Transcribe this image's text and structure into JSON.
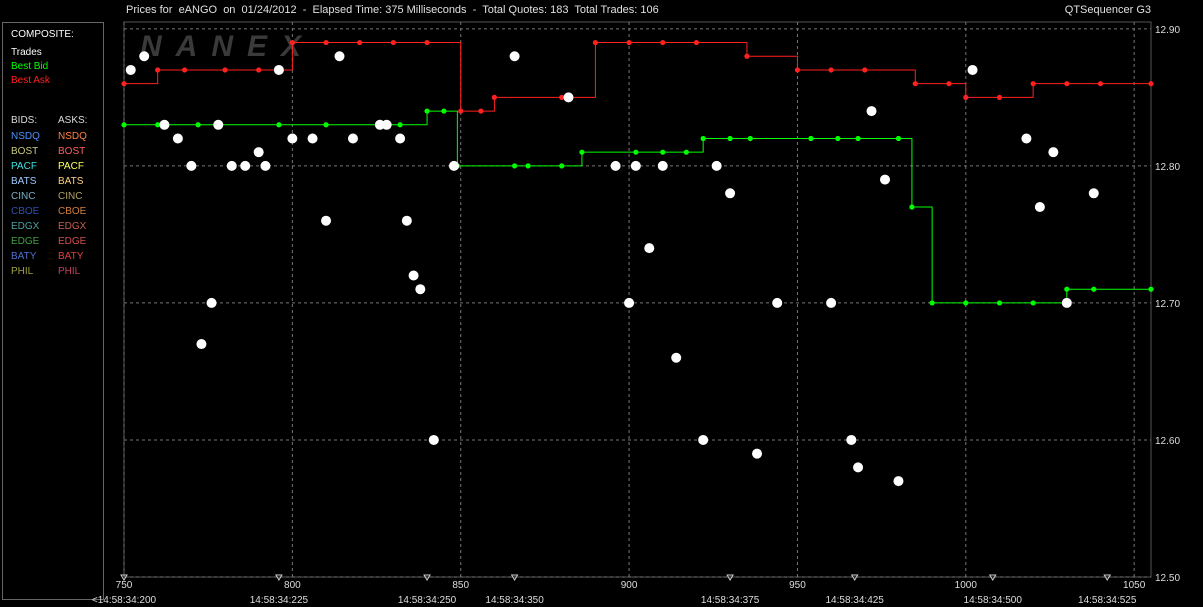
{
  "header": {
    "title": "Prices for  eANGO  on  01/24/2012  -  Elapsed Time: 375 Milliseconds  -  Total Quotes: 183  Total Trades: 106",
    "product": "QTSequencer G3",
    "watermark": "NANEX"
  },
  "legend": {
    "composite_label": "COMPOSITE:",
    "composite": [
      {
        "label": "Trades",
        "color": "#ffffff"
      },
      {
        "label": "Best Bid",
        "color": "#00ff00"
      },
      {
        "label": "Best Ask",
        "color": "#ff2020"
      }
    ],
    "bids_label": "BIDS:",
    "asks_label": "ASKS:",
    "bids": [
      {
        "label": "NSDQ",
        "color": "#4a90ff"
      },
      {
        "label": "BOST",
        "color": "#c8c87a"
      },
      {
        "label": "PACF",
        "color": "#40e0e0"
      },
      {
        "label": "BATS",
        "color": "#a0c8ff"
      },
      {
        "label": "CINC",
        "color": "#7ab0c8"
      },
      {
        "label": "CBOE",
        "color": "#3050b0"
      },
      {
        "label": "EDGX",
        "color": "#4aa0a0"
      },
      {
        "label": "EDGE",
        "color": "#40a040"
      },
      {
        "label": "BATY",
        "color": "#5070d0"
      },
      {
        "label": "PHIL",
        "color": "#a0a040"
      }
    ],
    "asks": [
      {
        "label": "NSDQ",
        "color": "#ff8040"
      },
      {
        "label": "BOST",
        "color": "#ff6060"
      },
      {
        "label": "PACF",
        "color": "#ffff60"
      },
      {
        "label": "BATS",
        "color": "#ffd080"
      },
      {
        "label": "CINC",
        "color": "#b0a060"
      },
      {
        "label": "CBOE",
        "color": "#d08040"
      },
      {
        "label": "EDGX",
        "color": "#c06050"
      },
      {
        "label": "EDGE",
        "color": "#d05050"
      },
      {
        "label": "BATY",
        "color": "#e04040"
      },
      {
        "label": "PHIL",
        "color": "#c04060"
      }
    ]
  },
  "chart_data": {
    "type": "line",
    "title": "Prices for  eANGO  on  01/24/2012",
    "xlim": [
      750,
      1055
    ],
    "ylim": [
      12.5,
      12.905
    ],
    "x_ticks": [
      "750",
      "800",
      "850",
      "900",
      "950",
      "1000",
      "1050"
    ],
    "x_tick_values": [
      750,
      800,
      850,
      900,
      950,
      1000,
      1050
    ],
    "y_ticks": [
      "12.90",
      "12.80",
      "12.70",
      "12.60",
      "12.50"
    ],
    "y_tick_values": [
      12.9,
      12.8,
      12.7,
      12.6,
      12.5
    ],
    "time_labels": [
      {
        "x": 750,
        "label": "<14:58:34:200"
      },
      {
        "x": 796,
        "label": "14:58:34:225"
      },
      {
        "x": 840,
        "label": "14:58:34:250"
      },
      {
        "x": 866,
        "label": "14:58:34:350"
      },
      {
        "x": 930,
        "label": "14:58:34:375"
      },
      {
        "x": 967,
        "label": "14:58:34:425"
      },
      {
        "x": 1008,
        "label": "14:58:34:500"
      },
      {
        "x": 1042,
        "label": "14:58:34:525"
      }
    ],
    "grid": true,
    "series": [
      {
        "name": "Best Bid",
        "color": "#00ff00",
        "x": [
          750,
          760,
          772,
          796,
          810,
          832,
          840,
          845,
          849,
          866,
          870,
          880,
          886,
          902,
          910,
          917,
          922,
          930,
          936,
          954,
          962,
          968,
          980,
          984,
          990,
          1000,
          1010,
          1020,
          1030,
          1038,
          1055
        ],
        "y": [
          12.83,
          12.83,
          12.83,
          12.83,
          12.83,
          12.83,
          12.84,
          12.84,
          12.8,
          12.8,
          12.8,
          12.8,
          12.81,
          12.81,
          12.81,
          12.81,
          12.82,
          12.82,
          12.82,
          12.82,
          12.82,
          12.82,
          12.82,
          12.77,
          12.7,
          12.7,
          12.7,
          12.7,
          12.71,
          12.71,
          12.71
        ]
      },
      {
        "name": "Best Ask",
        "color": "#ff2020",
        "x": [
          750,
          760,
          768,
          780,
          790,
          800,
          810,
          820,
          830,
          840,
          850,
          856,
          860,
          880,
          890,
          900,
          910,
          920,
          935,
          950,
          960,
          970,
          985,
          995,
          1000,
          1010,
          1020,
          1030,
          1040,
          1055
        ],
        "y": [
          12.86,
          12.87,
          12.87,
          12.87,
          12.87,
          12.89,
          12.89,
          12.89,
          12.89,
          12.89,
          12.84,
          12.84,
          12.85,
          12.85,
          12.89,
          12.89,
          12.89,
          12.89,
          12.88,
          12.87,
          12.87,
          12.87,
          12.86,
          12.86,
          12.85,
          12.85,
          12.86,
          12.86,
          12.86,
          12.86
        ]
      },
      {
        "name": "Trades",
        "color": "#ffffff",
        "x": [
          752,
          756,
          762,
          766,
          770,
          773,
          776,
          778,
          782,
          786,
          790,
          792,
          796,
          800,
          806,
          810,
          814,
          818,
          826,
          828,
          832,
          834,
          836,
          838,
          842,
          848,
          866,
          882,
          896,
          900,
          902,
          906,
          910,
          914,
          922,
          926,
          930,
          938,
          944,
          960,
          966,
          968,
          972,
          976,
          980,
          1002,
          1018,
          1022,
          1026,
          1030,
          1038
        ],
        "y": [
          12.87,
          12.88,
          12.83,
          12.82,
          12.8,
          12.67,
          12.7,
          12.83,
          12.8,
          12.8,
          12.81,
          12.8,
          12.87,
          12.82,
          12.82,
          12.76,
          12.88,
          12.82,
          12.83,
          12.83,
          12.82,
          12.76,
          12.72,
          12.71,
          12.6,
          12.8,
          12.88,
          12.85,
          12.8,
          12.7,
          12.8,
          12.74,
          12.8,
          12.66,
          12.6,
          12.8,
          12.78,
          12.59,
          12.7,
          12.7,
          12.6,
          12.58,
          12.84,
          12.79,
          12.57,
          12.87,
          12.82,
          12.77,
          12.81,
          12.7,
          12.78
        ]
      }
    ]
  }
}
